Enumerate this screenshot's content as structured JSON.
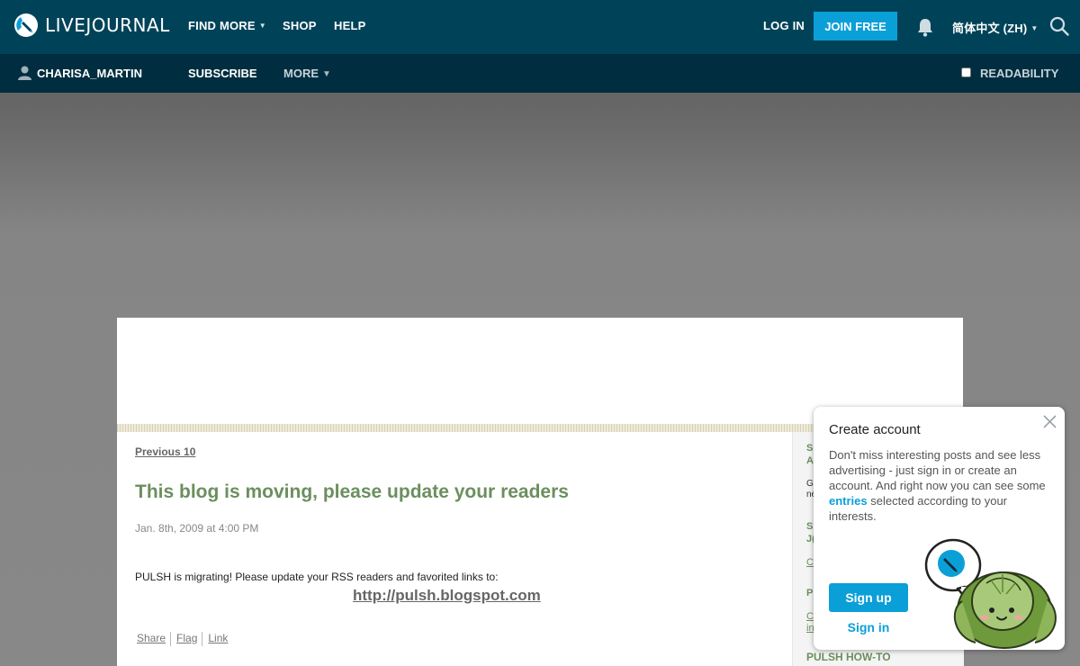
{
  "header": {
    "logo_text": "LIVEJOURNAL",
    "nav": [
      "FIND MORE",
      "SHOP",
      "HELP"
    ],
    "login_label": "LOG IN",
    "join_label": "JOIN FREE",
    "language_label": "简体中文 (ZH)"
  },
  "subheader": {
    "username": "CHARISA_MARTIN",
    "subscribe_label": "SUBSCRIBE",
    "more_label": "MORE",
    "readability_label": "READABILITY"
  },
  "post": {
    "previous_label": "Previous 10",
    "title": "This blog is moving, please update your readers",
    "date": "Jan. 8th, 2009 at 4:00 PM",
    "body": "PULSH is migrating! Please update your RSS readers and favorited links to:",
    "link": "http://pulsh.blogspot.com",
    "actions": [
      "Share",
      "Flag",
      "Link"
    ]
  },
  "sidebar": {
    "fragments": [
      "S",
      "A",
      "G",
      "ne",
      "S",
      "J(",
      "C",
      "P",
      "C",
      "in"
    ],
    "heading": "PULSH HOW-TO"
  },
  "popup": {
    "title": "Create account",
    "text_before": "Don't miss interesting posts and see less advertising - just sign in or create an account. And right now you can see some ",
    "text_link": "entries",
    "text_after": " selected according to your interests.",
    "signup_label": "Sign up",
    "signin_label": "Sign in"
  },
  "colors": {
    "topbar": "#004359",
    "subbar": "#002d3f",
    "accent": "#0b9fd8",
    "post_title": "#6b8f5e"
  }
}
